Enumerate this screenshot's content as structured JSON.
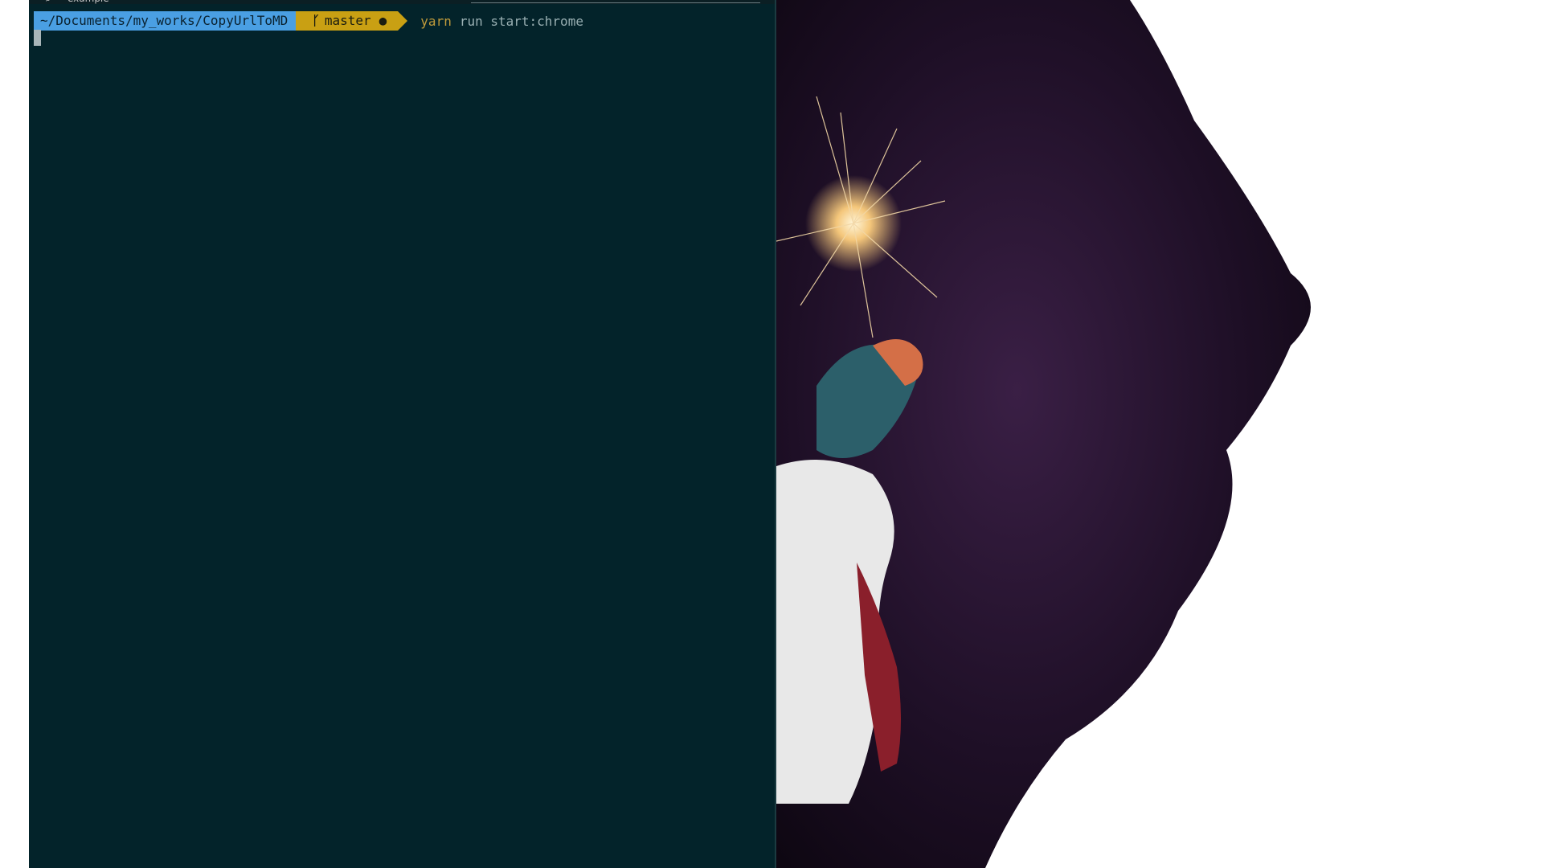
{
  "terminal": {
    "search_text": "example",
    "prompt": {
      "path": "~/Documents/my_works/CopyUrlToMD",
      "branch": "master",
      "branch_icon": "git-branch-icon",
      "dirty_indicator": "●"
    },
    "command": {
      "executable": "yarn",
      "args": "run start:chrome"
    }
  },
  "colors": {
    "terminal_bg": "#03232a",
    "path_segment": "#4a9fe3",
    "git_segment": "#c9a013",
    "command_text": "#9ab0b3",
    "executable_text": "#bf9a3b",
    "wallpaper_bg": "#2a1530"
  }
}
